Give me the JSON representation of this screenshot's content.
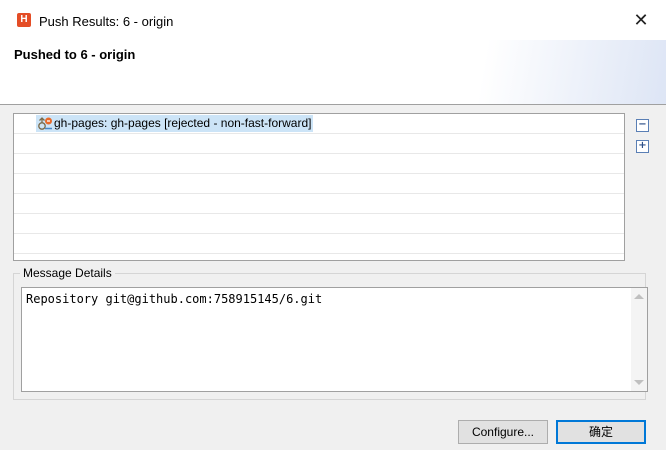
{
  "window": {
    "title": "Push Results: 6 - origin",
    "icon": "html-h-icon",
    "close_glyph": "✕"
  },
  "banner": {
    "heading": "Pushed to 6 - origin"
  },
  "results_tree": {
    "rows": [
      {
        "icon": "branch-push-icon",
        "label": "gh-pages: gh-pages [rejected - non-fast-forward]",
        "selected": true
      }
    ]
  },
  "side_buttons": {
    "collapse_glyph": "−",
    "expand_glyph": "+"
  },
  "message_details": {
    "label": "Message Details",
    "text": "Repository git@github.com:758915145/6.git"
  },
  "buttons": {
    "configure": "Configure...",
    "ok": "确定"
  },
  "colors": {
    "selection": "#cce4f7",
    "accent": "#0078d7",
    "icon_orange": "#e44d26"
  }
}
